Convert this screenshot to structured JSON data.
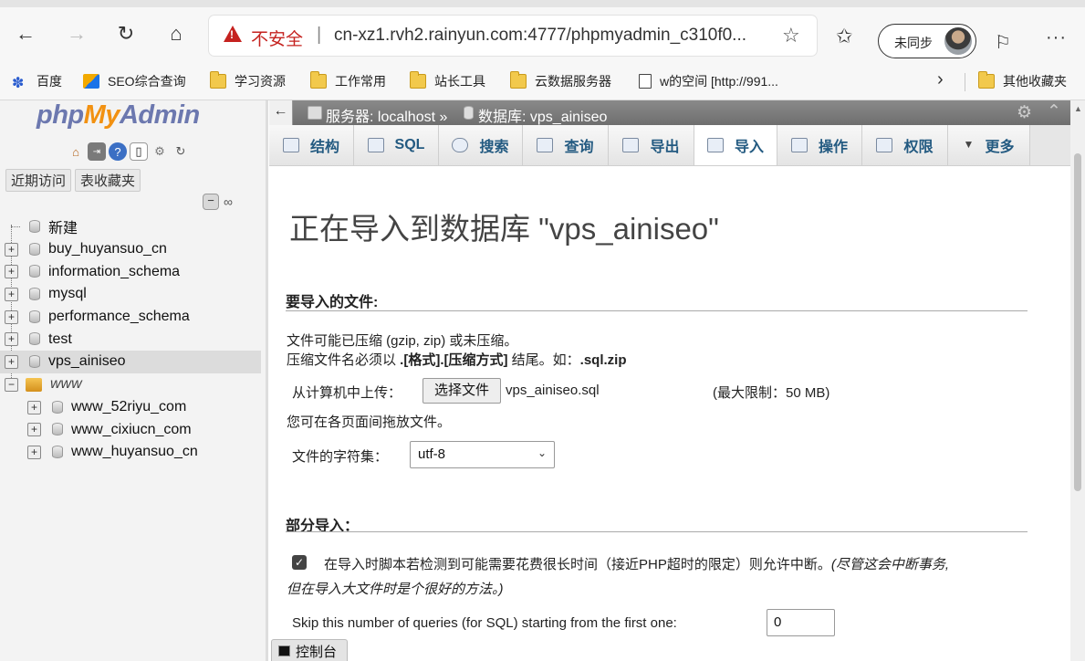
{
  "browser": {
    "security_label": "不安全",
    "separator": "|",
    "url": "cn-xz1.rvh2.rainyun.com:4777/phpmyadmin_c310f0...",
    "sync_label": "未同步",
    "bookmarks": [
      {
        "label": "百度",
        "icon": "paw-icon"
      },
      {
        "label": "SEO综合查询",
        "icon": "seo-icon"
      },
      {
        "label": "学习资源",
        "icon": "folder-icon"
      },
      {
        "label": "工作常用",
        "icon": "folder-icon"
      },
      {
        "label": "站长工具",
        "icon": "folder-icon"
      },
      {
        "label": "云数据服务器",
        "icon": "folder-icon"
      },
      {
        "label": "w的空间 [http://991...",
        "icon": "page-icon"
      }
    ],
    "other_bookmarks": "其他收藏夹"
  },
  "nav": {
    "logo": {
      "php": "php",
      "my": "My",
      "admin": "Admin"
    },
    "tabs": [
      "近期访问",
      "表收藏夹"
    ],
    "tree": {
      "new": "新建",
      "databases": [
        "buy_huyansuo_cn",
        "information_schema",
        "mysql",
        "performance_schema",
        "test",
        "vps_ainiseo"
      ],
      "selected": "vps_ainiseo",
      "group": "www",
      "group_children": [
        "www_52riyu_com",
        "www_cixiucn_com",
        "www_huyansuo_cn"
      ]
    }
  },
  "breadcrumb": {
    "server": "服务器: localhost »",
    "database": "数据库: vps_ainiseo"
  },
  "tabs": [
    {
      "label": "结构",
      "icon": "structure-icon"
    },
    {
      "label": "SQL",
      "icon": "sql-icon"
    },
    {
      "label": "搜索",
      "icon": "search-icon"
    },
    {
      "label": "查询",
      "icon": "query-icon"
    },
    {
      "label": "导出",
      "icon": "export-icon"
    },
    {
      "label": "导入",
      "icon": "import-icon",
      "active": true
    },
    {
      "label": "操作",
      "icon": "wrench-icon"
    },
    {
      "label": "权限",
      "icon": "privileges-icon"
    },
    {
      "label": "更多",
      "icon": "more-arrow-icon"
    }
  ],
  "import": {
    "title": "正在导入到数据库 \"vps_ainiseo\"",
    "file_section": "要导入的文件:",
    "compress_note": "文件可能已压缩 (gzip, zip) 或未压缩。",
    "compress_rule_prefix": "压缩文件名必须以 ",
    "compress_rule_format": ".[格式].[压缩方式]",
    "compress_rule_mid": " 结尾。如：",
    "compress_rule_example": ".sql.zip",
    "upload_label": "从计算机中上传：",
    "choose_file": "选择文件",
    "file_name": "vps_ainiseo.sql",
    "max_limit": "(最大限制：50 MB)",
    "drag_note": "您可在各页面间拖放文件。",
    "charset_label": "文件的字符集：",
    "charset_value": "utf-8",
    "partial_section": "部分导入：",
    "interrupt_text": "在导入时脚本若检测到可能需要花费很长时间（接近PHP超时的限定）则允许中断。",
    "interrupt_note_1": "(尽管这会中断事务,",
    "interrupt_note_2": "但在导入大文件时是个很好的方法。)",
    "interrupt_checked": true,
    "skip_label": "Skip this number of queries (for SQL) starting from the first one:",
    "skip_value": "0"
  },
  "console": {
    "label": "控制台"
  }
}
